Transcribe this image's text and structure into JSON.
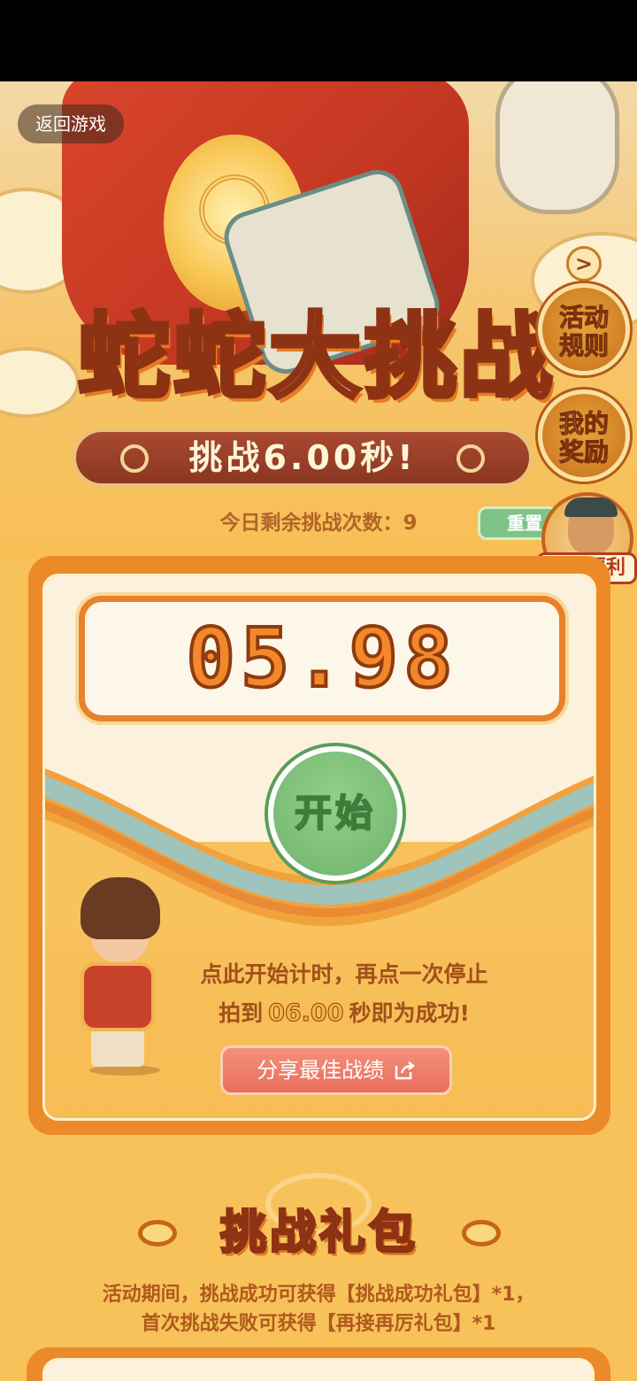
{
  "header": {
    "back_label": "返回游戏"
  },
  "event": {
    "title": "蛇蛇大挑战",
    "subtitle": "挑战6.00秒!"
  },
  "side_buttons": {
    "rules_label": "活动规则",
    "rewards_label": "我的奖励",
    "welfare_label": "肥肥福利",
    "arrow": ">"
  },
  "challenge": {
    "remaining_text": "今日剩余挑战次数：9",
    "reset_label": "重置",
    "timer_value": "05.98",
    "start_label": "开始",
    "hint_line1": "点此开始计时，再点一次停止",
    "hint_prefix": "拍到",
    "target_value": "06.00",
    "hint_suffix": "秒即为成功!",
    "share_label": "分享最佳战绩"
  },
  "gift": {
    "title": "挑战礼包",
    "desc_line1": "活动期间，挑战成功可获得【挑战成功礼包】*1，",
    "desc_line2": "首次挑战失败可获得【再接再厉礼包】*1"
  },
  "colors": {
    "background": "#f7c25a",
    "card_border": "#ec8a2a",
    "start_button": "#7bbd77",
    "accent_brown": "#8e3214"
  }
}
